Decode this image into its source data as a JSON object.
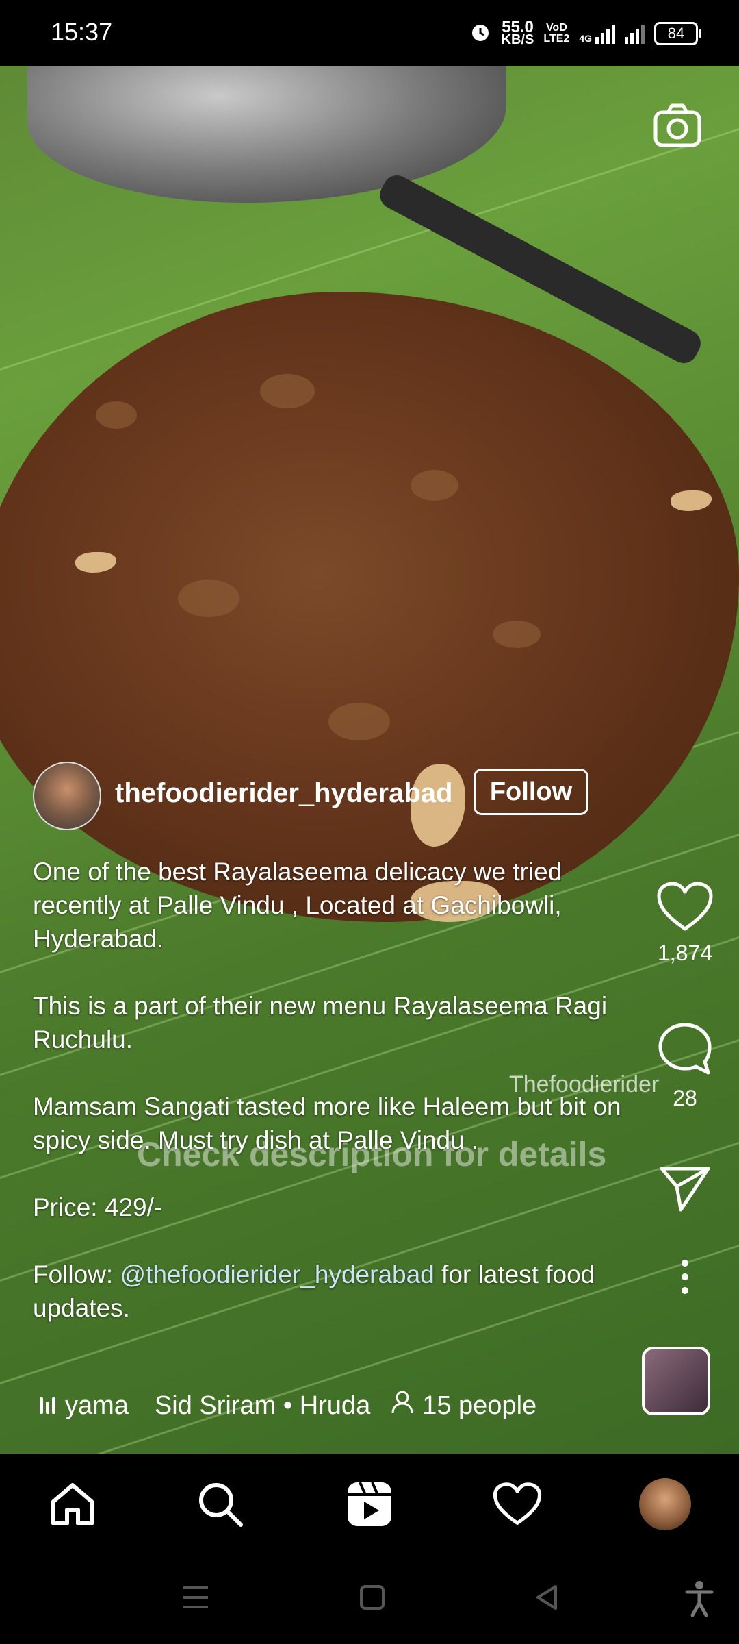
{
  "status_bar": {
    "time": "15:37",
    "speed_value": "55.0",
    "speed_unit": "KB/S",
    "volte": "VoD",
    "lte": "LTE2",
    "network": "4G",
    "battery": "84"
  },
  "post": {
    "username": "thefoodierider_hyderabad",
    "follow_label": "Follow",
    "caption": {
      "p1": "One of the best Rayalaseema delicacy we tried recently at Palle Vindu , Located at Gachibowli, Hyderabad.",
      "p2": "This is a part of their new menu  Rayalaseema Ragi Ruchulu.",
      "p3": "Mamsam Sangati tasted more like Haleem but bit on spicy side. Must try dish at Palle Vindu .",
      "p4": "Price: 429/-",
      "p5_prefix": "Follow: ",
      "p5_mention": "@thefoodierider_hyderabad",
      "p5_suffix": " for latest food updates."
    },
    "watermark": "Thefoodierider",
    "video_overlay_text": "Check description for details",
    "likes": "1,874",
    "comments": "28"
  },
  "audio": {
    "track_fragment": "yama",
    "artist_track": "Sid Sriram • Hruda",
    "people": "15 people"
  },
  "icons": {
    "camera": "camera-icon",
    "like": "heart-icon",
    "comment": "comment-icon",
    "share": "send-icon",
    "more": "more-vertical-icon",
    "home": "home-icon",
    "search": "search-icon",
    "reels": "reels-icon",
    "activity": "heart-outline-icon",
    "profile": "profile-avatar"
  }
}
